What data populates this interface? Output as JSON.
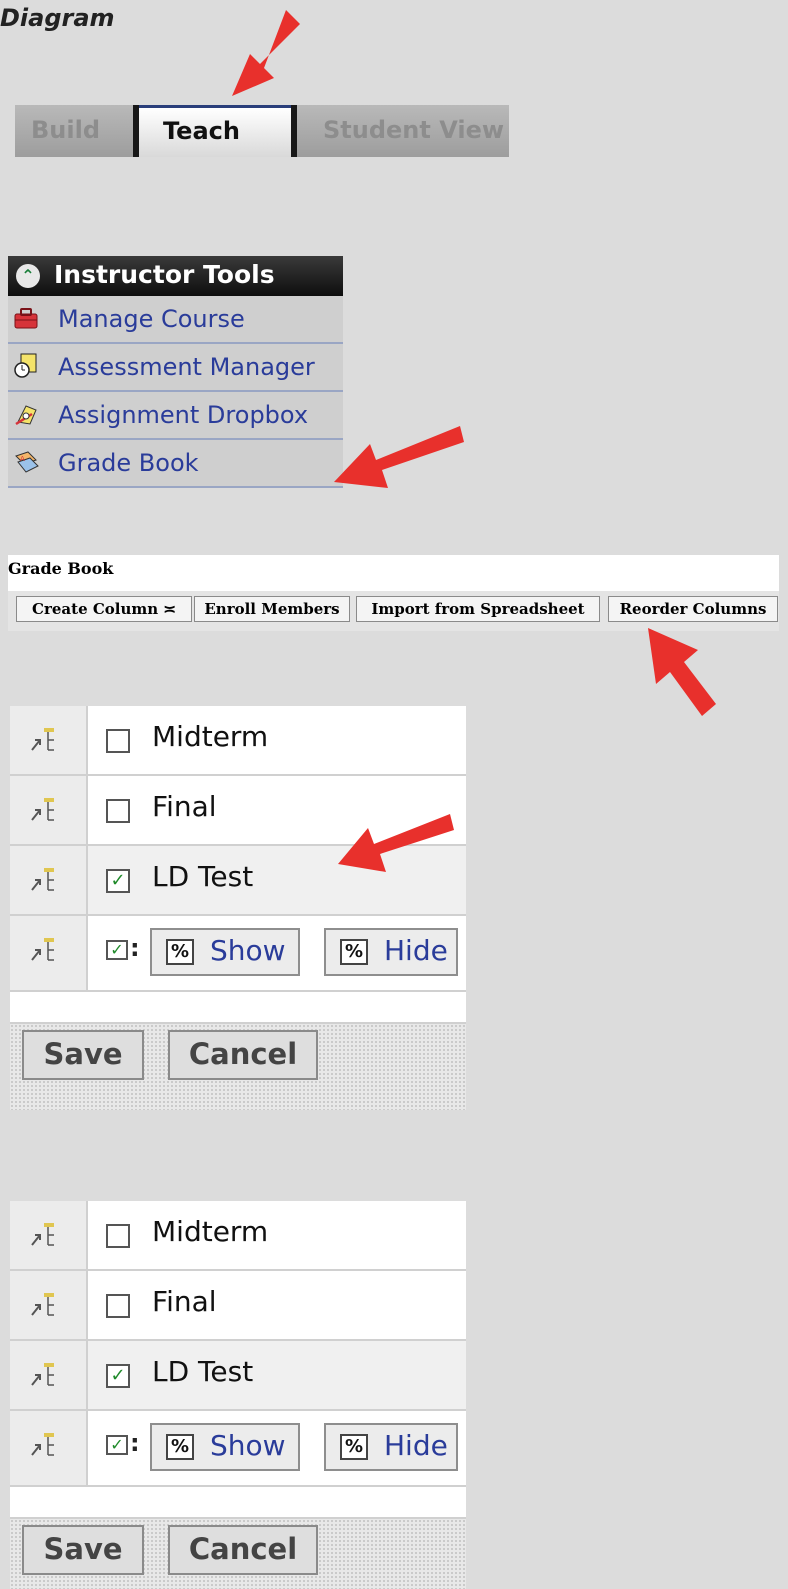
{
  "title": "Diagram",
  "tabs": [
    {
      "label": "Build",
      "active": false
    },
    {
      "label": "Teach",
      "active": true
    },
    {
      "label": "Student View",
      "active": false
    }
  ],
  "instructor_tools": {
    "header": "Instructor Tools",
    "items": [
      {
        "label": "Manage Course",
        "icon": "toolbox-icon"
      },
      {
        "label": "Assessment Manager",
        "icon": "clock-document-icon"
      },
      {
        "label": "Assignment Dropbox",
        "icon": "pen-document-icon"
      },
      {
        "label": "Grade Book",
        "icon": "grade-book-icon"
      }
    ]
  },
  "grade_book": {
    "title": "Grade Book",
    "buttons": [
      "Create Column",
      "Enroll Members",
      "Import from Spreadsheet",
      "Reorder Columns"
    ]
  },
  "reorder_panels": [
    {
      "rows": [
        {
          "label": "Midterm",
          "checked": false
        },
        {
          "label": "Final",
          "checked": false
        },
        {
          "label": "LD Test",
          "checked": true
        }
      ],
      "show_label": "Show",
      "hide_label": "Hide",
      "save_label": "Save",
      "cancel_label": "Cancel"
    },
    {
      "rows": [
        {
          "label": "Midterm",
          "checked": false
        },
        {
          "label": "Final",
          "checked": false
        },
        {
          "label": "LD Test",
          "checked": true
        }
      ],
      "show_label": "Show",
      "hide_label": "Hide",
      "save_label": "Save",
      "cancel_label": "Cancel"
    }
  ],
  "colors": {
    "arrow": "#e8302c",
    "link": "#2a3c9a",
    "check": "#1f8a2a"
  }
}
